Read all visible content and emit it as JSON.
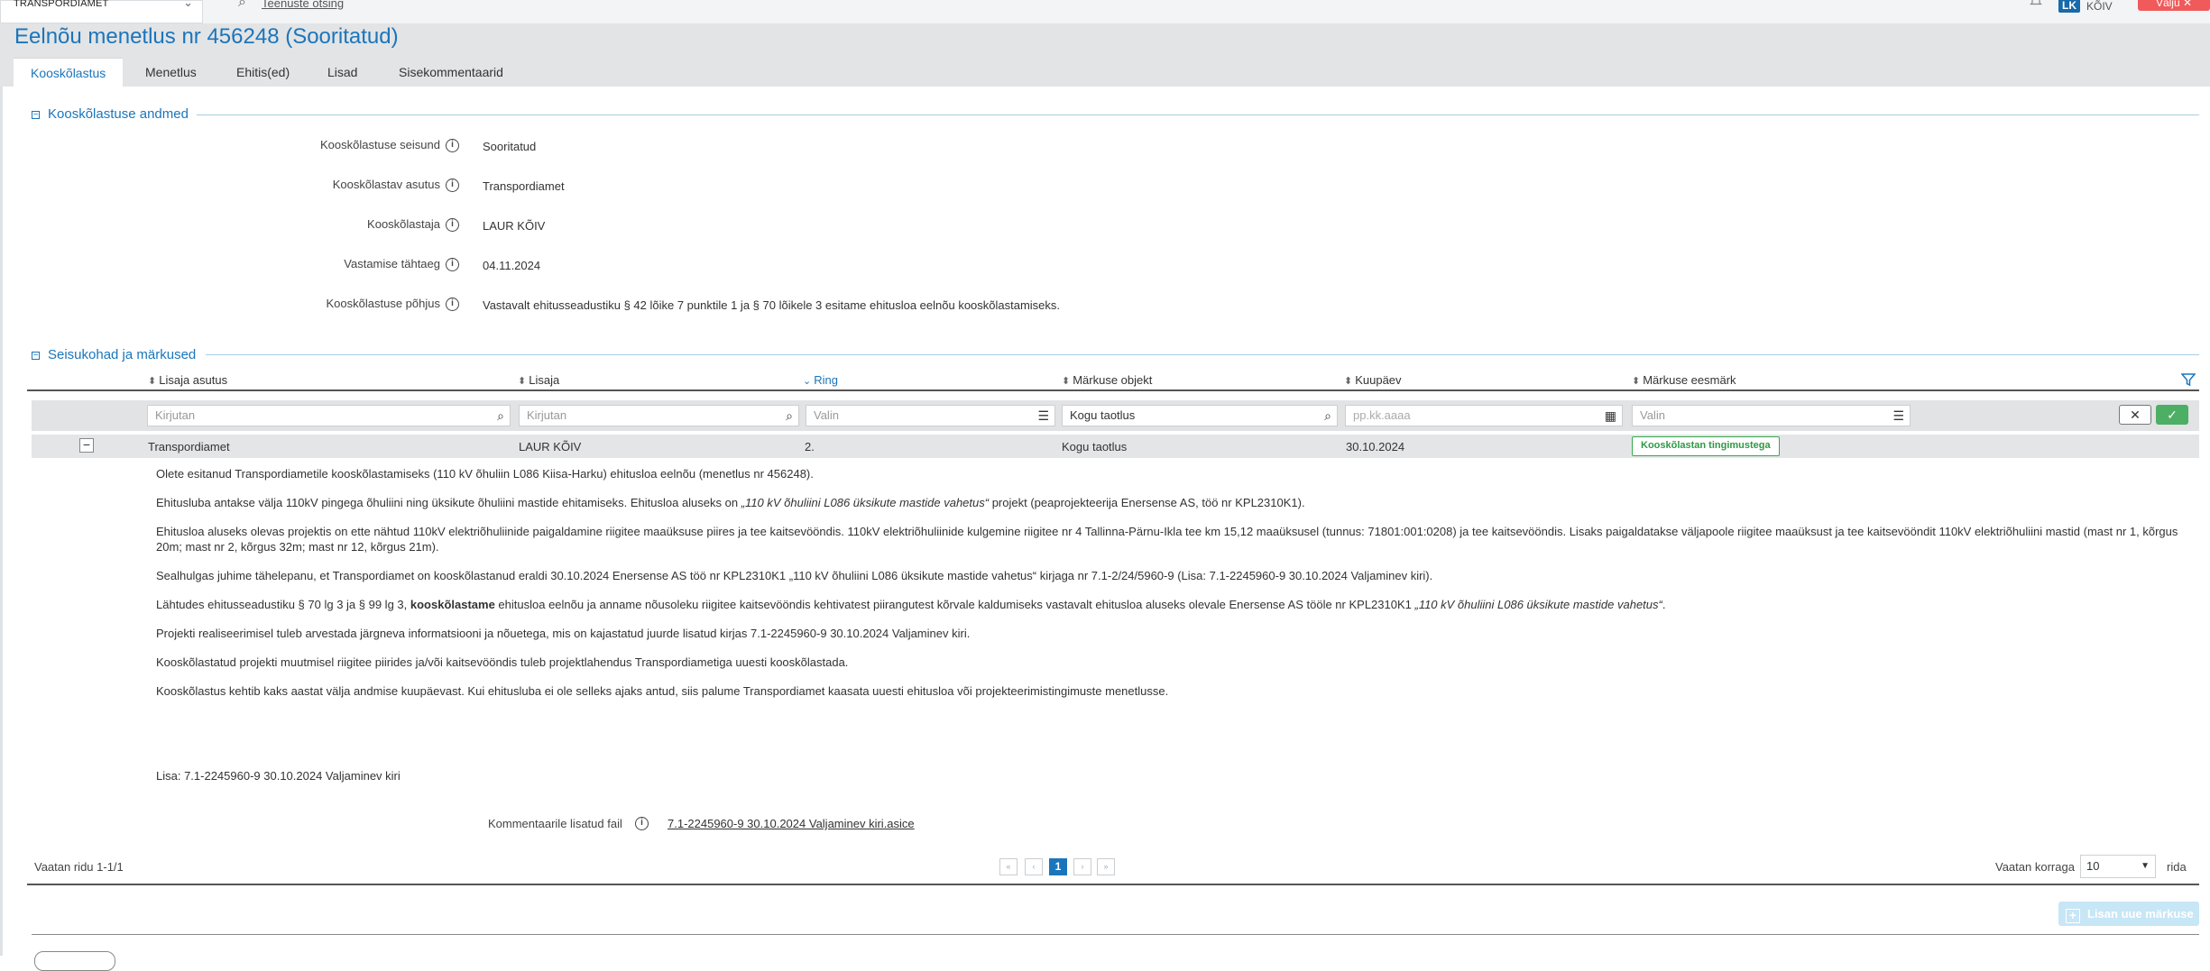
{
  "topbar": {
    "institution": "TRANSPORDIAMET",
    "search_link": "Teenuste otsing",
    "avatar_initials": "LK",
    "user_name": "KÕIV",
    "logout_label": "Välju"
  },
  "page": {
    "title": "Eelnõu menetlus nr 456248 (Sooritatud)",
    "tabs": [
      "Kooskõlastus",
      "Menetlus",
      "Ehitis(ed)",
      "Lisad",
      "Sisekommentaarid"
    ],
    "active_tab": "Kooskõlastus"
  },
  "details": {
    "section_title": "Kooskõlastuse andmed",
    "fields": [
      {
        "label": "Kooskõlastuse seisund",
        "value": "Sooritatud"
      },
      {
        "label": "Kooskõlastav asutus",
        "value": "Transpordiamet"
      },
      {
        "label": "Kooskõlastaja",
        "value": "LAUR KÕIV"
      },
      {
        "label": "Vastamise tähtaeg",
        "value": "04.11.2024"
      },
      {
        "label": "Kooskõlastuse põhjus",
        "value": "Vastavalt ehitusseadustiku § 42 lõike 7 punktile 1 ja § 70 lõikele 3 esitame ehitusloa eelnõu kooskõlastamiseks."
      }
    ]
  },
  "remarks": {
    "section_title": "Seisukohad ja märkused",
    "columns": [
      "Lisaja asutus",
      "Lisaja",
      "Ring",
      "Märkuse objekt",
      "Kuupäev",
      "Märkuse eesmärk"
    ],
    "filters": {
      "lisaja_asutus": "Kirjutan",
      "lisaja": "Kirjutan",
      "ring": "Valin",
      "markuse_objekt": "Kogu taotlus",
      "kuupaev": "pp.kk.aaaa",
      "eesmark": "Valin"
    },
    "row": {
      "asutus": "Transpordiamet",
      "lisaja": "LAUR KÕIV",
      "ring": "2.",
      "objekt": "Kogu taotlus",
      "kuupaev": "30.10.2024",
      "eesmark": "Kooskõlastan tingimustega"
    },
    "body": {
      "p1": "Olete esitanud Transpordiametile kooskõlastamiseks (110 kV õhuliin L086 Kiisa-Harku) ehitusloa eelnõu (menetlus nr 456248).",
      "p2a": "Ehitusluba antakse välja 110kV pingega õhuliini ning üksikute õhuliini mastide ehitamiseks. Ehitusloa aluseks on ",
      "p2b": "„110 kV õhuliini L086 üksikute mastide vahetus“",
      "p2c": " projekt (peaprojekteerija Enersense AS, töö nr KPL2310K1).",
      "p3": "Ehitusloa aluseks olevas projektis on ette nähtud 110kV elektriõhuliinide paigaldamine riigitee maaüksuse piires ja tee kaitsevööndis. 110kV elektriõhuliinide kulgemine riigitee nr 4 Tallinna-Pärnu-Ikla tee km 15,12 maaüksusel (tunnus: 71801:001:0208) ja tee kaitsevööndis. Lisaks paigaldatakse väljapoole riigitee maaüksust ja tee kaitsevööndit 110kV elektriõhuliini mastid (mast nr 1, kõrgus 20m; mast nr 2, kõrgus 32m; mast nr 12, kõrgus 21m).",
      "p4": "Sealhulgas juhime tähelepanu, et Transpordiamet on kooskõlastanud eraldi 30.10.2024 Enersense AS töö nr KPL2310K1 „110 kV õhuliini L086 üksikute mastide vahetus“ kirjaga nr 7.1-2/24/5960-9 (Lisa: 7.1-2245960-9 30.10.2024 Valjaminev kiri).",
      "p5a": "Lähtudes ehitusseadustiku § 70 lg 3 ja § 99 lg 3, ",
      "p5b": "kooskõlastame",
      "p5c": " ehitusloa eelnõu ja anname nõusoleku riigitee kaitsevööndis kehtivatest piirangutest kõrvale kaldumiseks vastavalt ehitusloa aluseks olevale Enersense AS tööle nr KPL2310K1 ",
      "p5d": "„110 kV õhuliini L086 üksikute mastide vahetus“",
      "p5e": ".",
      "p6": "Projekti realiseerimisel tuleb arvestada järgneva informatsiooni ja nõuetega, mis on kajastatud juurde lisatud kirjas 7.1-2245960-9 30.10.2024 Valjaminev kiri.",
      "p7": "Kooskõlastatud projekti muutmisel riigitee piirides ja/või kaitsevööndis tuleb projektlahendus Transpordiametiga uuesti kooskõlastada.",
      "p8": "Kooskõlastus kehtib kaks aastat välja andmise kuupäevast. Kui ehitusluba ei ole selleks ajaks antud, siis palume Transpordiamet kaasata uuesti ehitusloa või projekteerimistingimuste menetlusse.",
      "p9": "Lisa: 7.1-2245960-9 30.10.2024 Valjaminev kiri"
    },
    "attachment_label": "Kommentaarile lisatud fail",
    "attachment_link": "7.1-2245960-9 30.10.2024 Valjaminev kiri.asice",
    "paging_text": "Vaatan ridu 1-1/1",
    "current_page": "1",
    "page_size_label": "Vaatan korraga",
    "page_size": "10",
    "rows_label": "rida",
    "add_button": "Lisan uue märkuse"
  },
  "icons": {
    "search": "search-icon",
    "info": "info-icon",
    "list": "list-icon",
    "calendar": "calendar-icon",
    "filter": "funnel-icon",
    "bell": "bell-icon"
  },
  "colors": {
    "accent": "#1b75bb",
    "success": "#39a84f",
    "danger": "#f15a5a",
    "header_band": "#e2e4e6"
  }
}
